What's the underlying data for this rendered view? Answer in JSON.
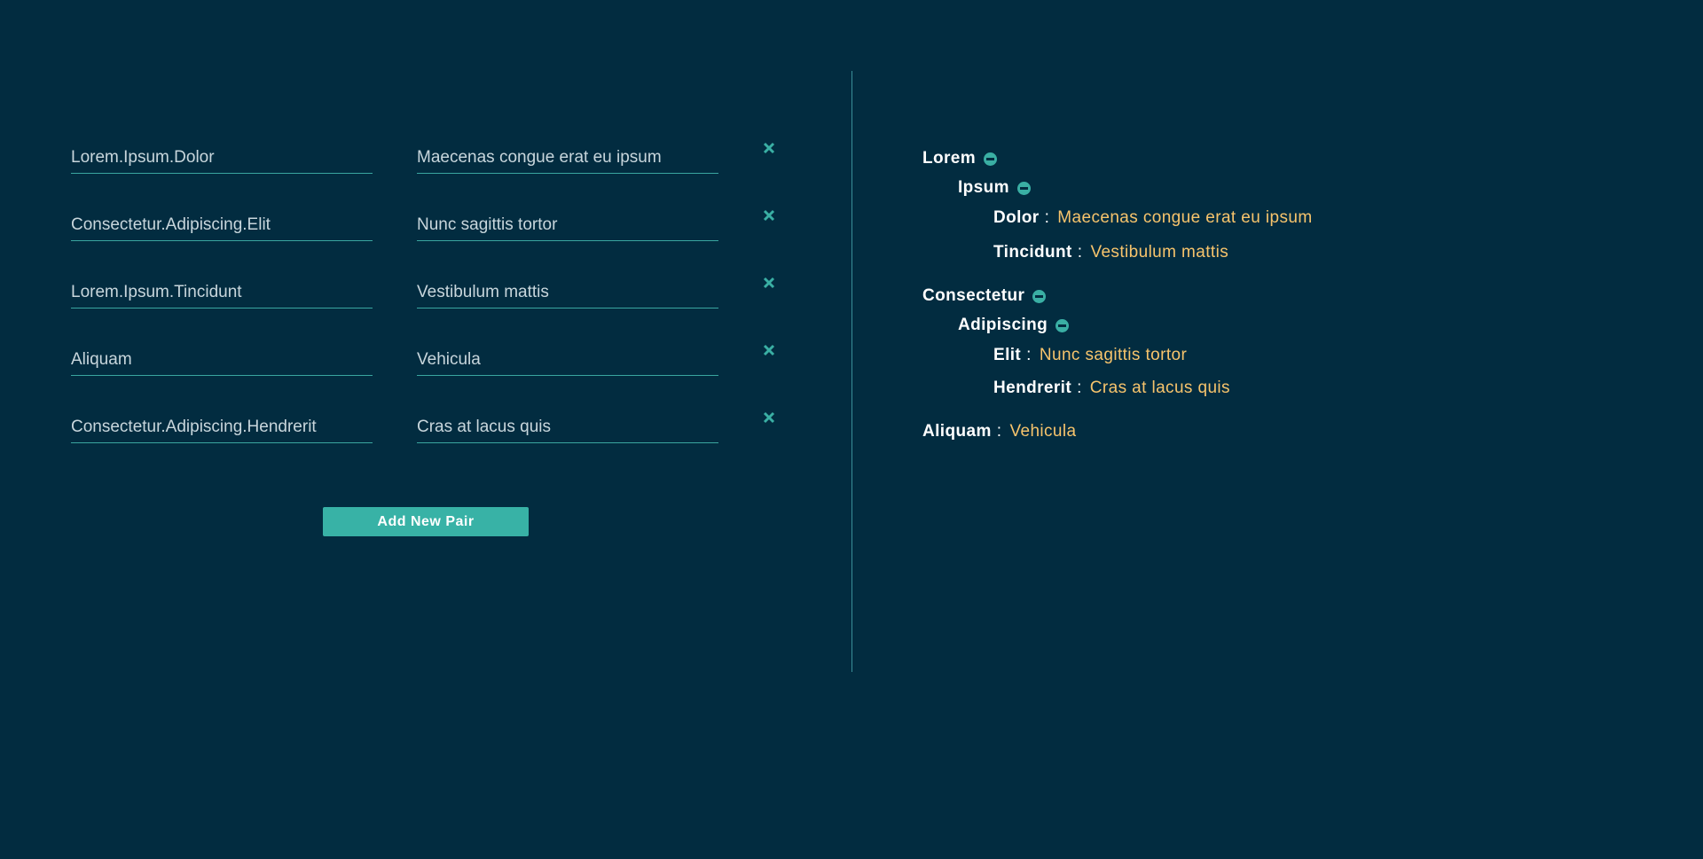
{
  "editor": {
    "pairs": [
      {
        "key": "Lorem.Ipsum.Dolor",
        "value": "Maecenas congue erat eu ipsum"
      },
      {
        "key": "Consectetur.Adipiscing.Elit",
        "value": "Nunc sagittis tortor"
      },
      {
        "key": "Lorem.Ipsum.Tincidunt",
        "value": "Vestibulum mattis"
      },
      {
        "key": "Aliquam",
        "value": "Vehicula"
      },
      {
        "key": "Consectetur.Adipiscing.Hendrerit",
        "value": "Cras at lacus quis"
      }
    ],
    "remove_icon": "close-icon",
    "add_button_label": "Add New Pair"
  },
  "preview": {
    "separator": ":",
    "tree": [
      {
        "key": "Lorem",
        "children": [
          {
            "key": "Ipsum",
            "children": [
              {
                "key": "Dolor",
                "value": "Maecenas congue erat eu ipsum"
              },
              {
                "key": "Tincidunt",
                "value": "Vestibulum mattis"
              }
            ]
          }
        ]
      },
      {
        "key": "Consectetur",
        "children": [
          {
            "key": "Adipiscing",
            "children": [
              {
                "key": "Elit",
                "value": "Nunc sagittis tortor"
              },
              {
                "key": "Hendrerit",
                "value": "Cras at lacus quis"
              }
            ]
          }
        ]
      },
      {
        "key": "Aliquam",
        "value": "Vehicula"
      }
    ]
  },
  "colors": {
    "background": "#022c40",
    "accent": "#38b2a6",
    "value_text": "#f7c46c",
    "key_text": "#ffffff"
  }
}
